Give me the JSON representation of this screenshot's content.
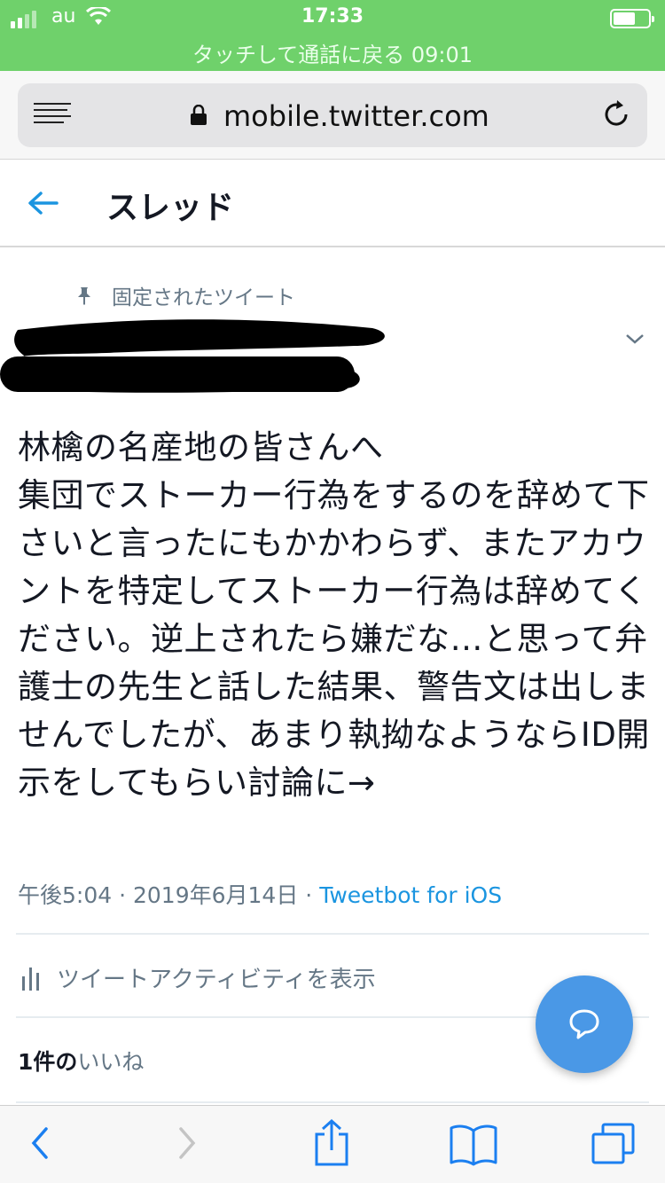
{
  "status_bar": {
    "carrier": "au",
    "time": "17:33",
    "call_banner": "タッチして通話に戻る 09:01",
    "background_color": "#6fd16b"
  },
  "browser": {
    "url": "mobile.twitter.com",
    "icons": [
      "reader-icon",
      "lock-icon",
      "reload-icon"
    ]
  },
  "header": {
    "title": "スレッド",
    "back_icon": "back-arrow-icon"
  },
  "tweet": {
    "pinned_label": "固定されたツイート",
    "author_redacted": true,
    "text": "林檎の名産地の皆さんへ\n集団でストーカー行為をするのを辞めて下さいと言ったにもかかわらず、またアカウントを特定してストーカー行為は辞めてください。逆上されたら嫌だな…と思って弁護士の先生と話した結果、警告文は出しませんでしたが、あまり執拗なようならID開示をしてもらい討論に→",
    "time": "午後5:04",
    "date": "2019年6月14日",
    "separator": "·",
    "source": "Tweetbot for iOS",
    "activity_label": "ツイートアクティビティを表示",
    "likes_count": "1件の",
    "likes_label": "いいね"
  },
  "colors": {
    "accent": "#1b95e0",
    "fab": "#4a98e6",
    "secondary_text": "#657786"
  }
}
